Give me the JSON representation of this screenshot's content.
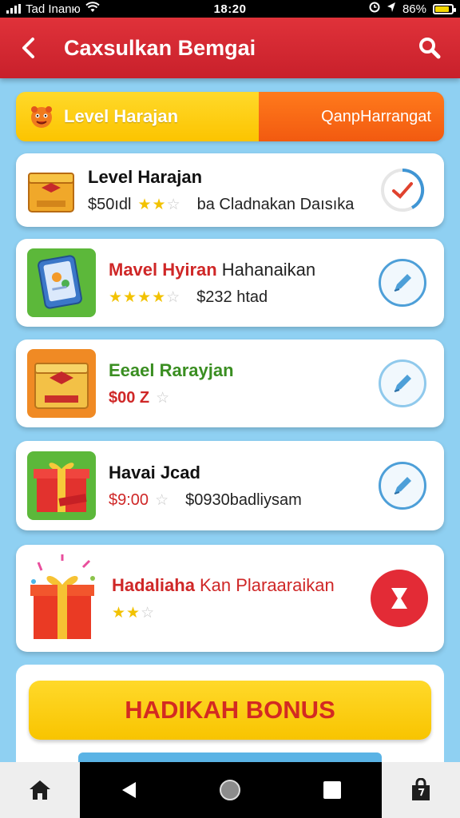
{
  "status_bar": {
    "carrier": "Tad Inanю",
    "time": "18:20",
    "battery": "86%"
  },
  "app_bar": {
    "title": "Cахsulkan Bemgai"
  },
  "level_banner": {
    "left_label": "Level Harajan",
    "right_label": "QanpHarrangat"
  },
  "items": [
    {
      "title": "Level Harajan",
      "price": "$50ıdl",
      "rating": 2,
      "max_rating": 3,
      "extra": "ba   Cladnakan Daısıka",
      "action": "progress"
    },
    {
      "title": "Mavel Hyiran",
      "title_extra": "Hahanaikan",
      "rating": 4,
      "max_rating": 5,
      "extra": "$232  htad",
      "action": "edit"
    },
    {
      "title": "Eeael Rarayjan",
      "price": "$00  Z",
      "rating": 0,
      "max_rating": 1,
      "action": "edit"
    },
    {
      "title": "Havai Jcad",
      "price": "$9:00",
      "rating": 0,
      "max_rating": 1,
      "extra": "$0930badliysam",
      "action": "edit"
    },
    {
      "title": "Hadaliaha",
      "title_extra": "Kan Plaraaraikan",
      "rating": 2,
      "max_rating": 3,
      "action": "hourglass"
    }
  ],
  "bonus_button": {
    "label": "HADIKAH BONUS"
  },
  "colors": {
    "header": "#d52830",
    "accent_yellow": "#fcc400",
    "accent_orange": "#f25a10",
    "background": "#8fd0f2",
    "red_title": "#d32a22",
    "green_title": "#3a8e21"
  },
  "icons": [
    "back-icon",
    "search-icon",
    "home-icon",
    "android-back-icon",
    "android-home-icon",
    "android-recents-icon",
    "bag-icon"
  ]
}
